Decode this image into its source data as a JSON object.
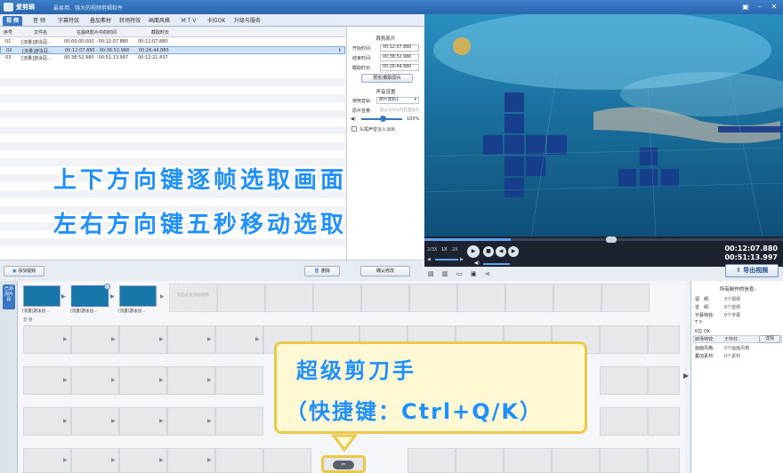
{
  "titlebar": {
    "app_name": "爱剪辑",
    "slogan": "最易用、强大的视频剪辑软件",
    "window_controls": [
      "restore-icon",
      "minimize-icon",
      "close-icon"
    ]
  },
  "tabs": [
    {
      "label": "视 频",
      "active": true
    },
    {
      "label": "音 频"
    },
    {
      "label": "字幕特效"
    },
    {
      "label": "叠加素材"
    },
    {
      "label": "转场特效"
    },
    {
      "label": "画面风格"
    },
    {
      "label": "M T V"
    },
    {
      "label": "卡拉OK"
    },
    {
      "label": "升级与服务"
    }
  ],
  "file_table": {
    "headers": [
      "序号",
      "文件名",
      "在最终影片中的时间",
      "截取时长"
    ],
    "rows": [
      {
        "no": "01",
        "name": "[流量]游泳冠...",
        "range": "00:00:00.000 - 00:12:07.880",
        "dur": "00:12:07.880"
      },
      {
        "no": "02",
        "name": "[流量]游泳冠...",
        "range": "00:12:07.880 - 00:38:52.988",
        "dur": "00:26:44.880",
        "selected": true
      },
      {
        "no": "03",
        "name": "[流量]游泳冠...",
        "range": "00:38:52.980 - 00:51:13.997",
        "dur": "00:12:21.437"
      }
    ]
  },
  "clip_panel": {
    "trim_title": "裁剪原片",
    "start_label": "开始时间:",
    "start_value": "00:12:07.880",
    "end_label": "结束时间:",
    "end_value": "00:38:52.980",
    "dur_label": "截取时长:",
    "dur_value": "00:26:44.880",
    "preview_btn": "预览/截取原片",
    "audio_title": "声音设置",
    "track_label": "使用音轨:",
    "track_value": "原片音轨1",
    "volume_label": "原片音量:",
    "volume_hint": "超过100%时音量放大",
    "volume_value": "100%",
    "fade_label": "头尾声音淡入淡出",
    "confirm_btn": "确认修改"
  },
  "bottombar": {
    "add_video": "添加视频",
    "delete": "删除"
  },
  "overlay": {
    "line1": "上下方向键逐帧选取画面",
    "line2": "左右方向键五秒移动选取"
  },
  "player": {
    "speed_labels": [
      "2/3X",
      "1X",
      "2X"
    ],
    "time_current": "00:12:07.880",
    "time_total": "00:51:13.997",
    "progress": 0.24,
    "export_btn": "导出视频"
  },
  "timeline": {
    "side_tab": "已添加片段",
    "clips": [
      {
        "label": "[流量]游泳冠..."
      },
      {
        "label": "[流量]游泳冠...",
        "selected": true
      },
      {
        "label": "[流量]游泳冠..."
      }
    ],
    "empty_hint": "双击此处添加视频",
    "audio_track_label": "音 频"
  },
  "info_panel": {
    "title": "所有制作的信息:",
    "items": [
      {
        "k": "视　频:",
        "v": "3个视频"
      },
      {
        "k": "音　频:",
        "v": "0个音频"
      },
      {
        "k": "字幕特效:",
        "v": "0个字幕"
      },
      {
        "k": "T Y:",
        "v": ""
      },
      {
        "k": "K拉 OK:",
        "v": ""
      },
      {
        "k": "转场特效:",
        "v": "无特效"
      },
      {
        "k": "画面风格:",
        "v": "0个画面风格"
      },
      {
        "k": "叠加素材:",
        "v": "0个素材"
      }
    ],
    "detail_btn": "详情"
  },
  "tooltip": {
    "line1": "超级剪刀手",
    "line2": "（快捷键：Ctrl+Q/K）"
  },
  "colors": {
    "accent": "#3676c4",
    "overlay_text": "#1e90ff",
    "tooltip_bg": "#fff8d2",
    "tooltip_border": "#ecc84a"
  }
}
